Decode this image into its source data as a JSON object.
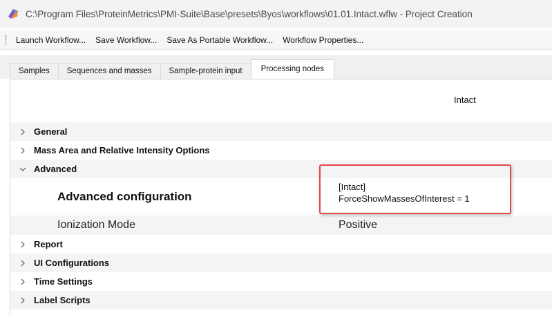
{
  "window": {
    "title": "C:\\Program Files\\ProteinMetrics\\PMI-Suite\\Base\\presets\\Byos\\workflows\\01.01.Intact.wflw - Project Creation",
    "app_icon": "pmi-logo-icon"
  },
  "toolbar": {
    "items": [
      "Launch Workflow...",
      "Save Workflow...",
      "Save As Portable Workflow...",
      "Workflow Properties..."
    ]
  },
  "tabs": {
    "items": [
      "Samples",
      "Sequences and masses",
      "Sample-protein input",
      "Processing nodes"
    ],
    "active": "Processing nodes"
  },
  "grid": {
    "column_header": "Intact",
    "categories": {
      "general": "General",
      "mass_area": "Mass Area and Relative Intensity Options",
      "advanced": "Advanced",
      "report": "Report",
      "ui_config": "UI Configurations",
      "time_settings": "Time Settings",
      "label_scripts": "Label Scripts"
    },
    "advanced_props": {
      "config_label": "Advanced configuration",
      "config_value_line1": "[Intact]",
      "config_value_line2": "ForceShowMassesOfInterest = 1",
      "ionization_label": "Ionization Mode",
      "ionization_value": "Positive"
    }
  },
  "colors": {
    "highlight_border": "#e04848",
    "row_alt": "#f4f4f4"
  }
}
